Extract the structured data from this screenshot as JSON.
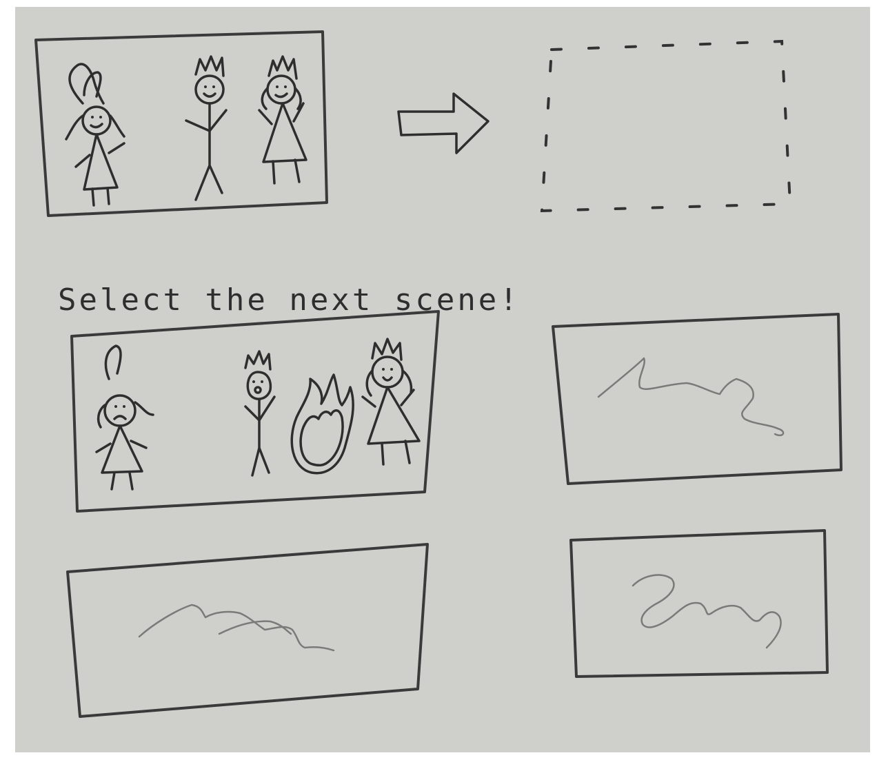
{
  "prompt": {
    "text": "Select the next scene!"
  },
  "current_scene": {
    "characters": [
      "girl-with-hat",
      "king",
      "queen"
    ],
    "mood": "happy"
  },
  "next_scene_slot": {
    "state": "empty"
  },
  "options": [
    {
      "characters": [
        "sad-girl-with-hat",
        "shocked-king",
        "fire",
        "queen"
      ],
      "content": "illustrated"
    },
    {
      "content": "scribble"
    },
    {
      "content": "scribble"
    },
    {
      "content": "scribble"
    }
  ],
  "icons": {
    "arrow": "arrow-right-icon",
    "fire": "fire-icon"
  },
  "colors": {
    "paper": "#cfcfcb",
    "ink": "#2e2e2e",
    "pencil": "#7a7a78"
  }
}
